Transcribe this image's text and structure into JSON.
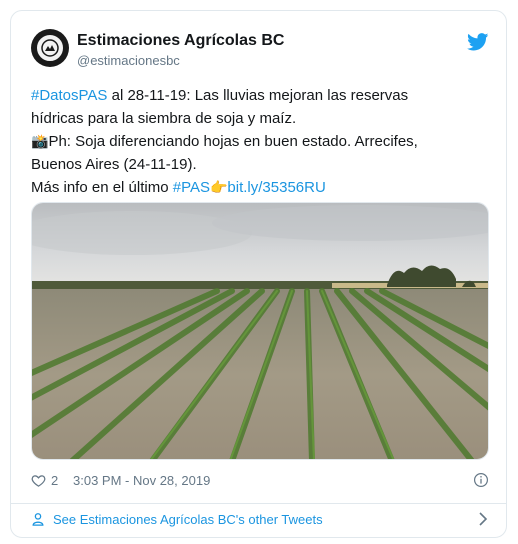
{
  "user": {
    "display_name": "Estimaciones Agrícolas BC",
    "handle": "@estimacionesbc",
    "avatar_icon": "seal-logo-icon"
  },
  "tweet": {
    "line1_hashtag": "#DatosPAS",
    "line1_text": " al 28-11-19: Las lluvias mejoran las reservas",
    "line2_text": "hídricas para la siembra de soja y maíz.",
    "line3_emoji": "📸",
    "line3_text": "Ph: Soja diferenciando hojas en buen estado. Arrecifes,",
    "line4_text": "Buenos Aires (24-11-19).",
    "line5_text": "Más info en el último ",
    "line5_hashtag": "#PAS",
    "line5_emoji": "👉",
    "line5_link": "bit.ly/35356RU"
  },
  "meta": {
    "likes": "2",
    "timestamp": "3:03 PM - Nov 28, 2019"
  },
  "footer": {
    "other_tweets": "See Estimaciones Agrícolas BC's other Tweets"
  },
  "colors": {
    "link": "#1b95e0",
    "twitter_blue": "#1da1f2",
    "muted": "#657786"
  }
}
